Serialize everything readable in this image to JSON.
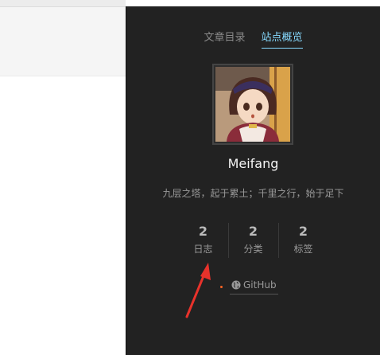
{
  "sidebar": {
    "tabs": [
      {
        "label": "文章目录",
        "active": false
      },
      {
        "label": "站点概览",
        "active": true
      }
    ],
    "site_name": "Meifang",
    "description": "九层之塔，起于累土；千里之行，始于足下",
    "stats": [
      {
        "count": "2",
        "label": "日志"
      },
      {
        "count": "2",
        "label": "分类"
      },
      {
        "count": "2",
        "label": "标签"
      }
    ],
    "links": [
      {
        "label": "GitHub",
        "icon": "globe-icon"
      }
    ],
    "colors": {
      "background": "#222222",
      "active_tab": "#87daff",
      "text_muted": "#999999",
      "site_name": "#f5f5f5",
      "link_dot": "#fc6423",
      "annotation_arrow": "#e8322b"
    }
  }
}
